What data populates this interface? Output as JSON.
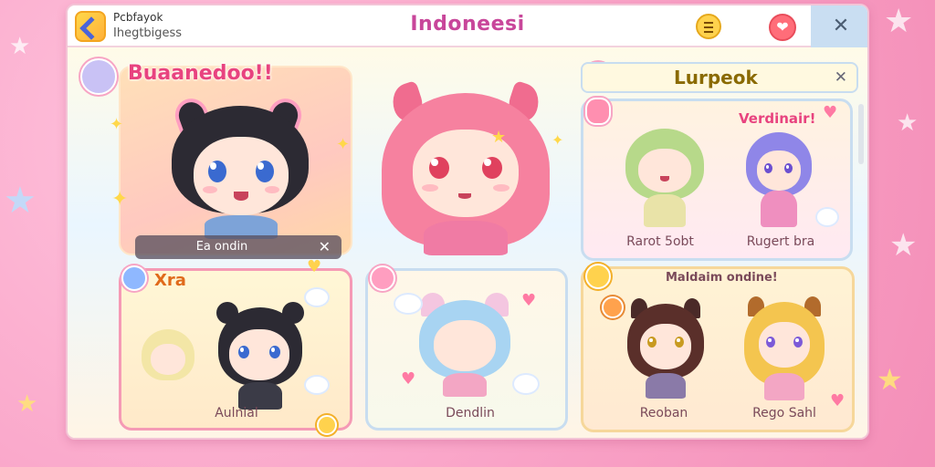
{
  "app": {
    "name": "Pcbfayok",
    "subtitle": "Ihegtbigess",
    "title": "Indoneesi"
  },
  "titlebar": {
    "menu_icon": "hamburger-icon",
    "favorite_icon": "heart-icon",
    "close_icon": "close-icon",
    "close_symbol": "✕",
    "heart_symbol": "❤"
  },
  "cards": {
    "featured": {
      "title": "Buaanedoo!!",
      "caption": "Ea ondin",
      "close_symbol": "✕"
    },
    "center": {
      "name": ""
    },
    "lurpeok": {
      "title": "Lurpeok",
      "close_symbol": "✕",
      "tag": "Verdinair!",
      "labels": [
        "Rarot 5obt",
        "Rugert bra"
      ]
    },
    "xira": {
      "title": "Xra",
      "caption": "Aulnial"
    },
    "dendlin": {
      "caption": "Dendlin"
    },
    "maldaim": {
      "title": "Maldaim ondine!",
      "labels": [
        "Reoban",
        "Rego Sahl"
      ]
    }
  },
  "colors": {
    "accent": "#c8469a",
    "background": "#f9a3c7",
    "featured_card": "#ffd7a8",
    "lurpeok_border": "#c8ddf0",
    "xira_border": "#f59ab5"
  }
}
